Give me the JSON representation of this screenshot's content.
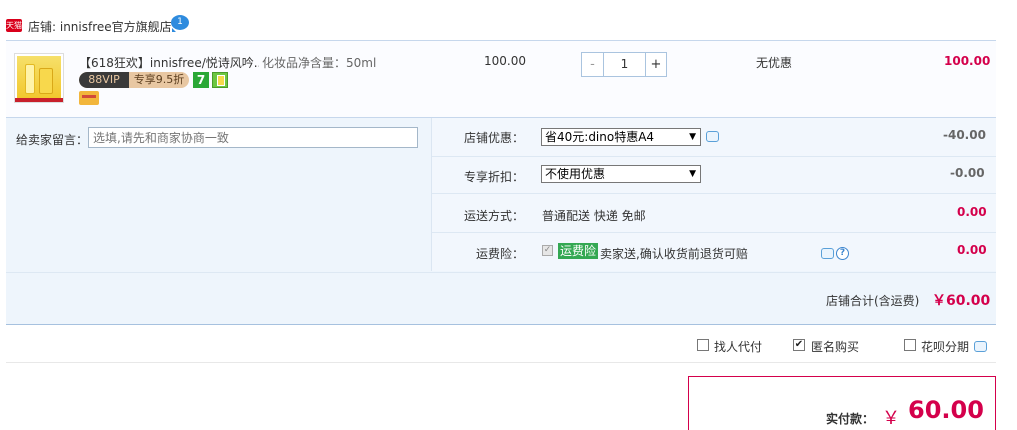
{
  "store": {
    "badge": "天猫",
    "label": "店铺: innisfree官方旗舰店",
    "chat_badge": "1"
  },
  "item": {
    "title": "【618狂欢】innisfree/悦诗风吟...",
    "spec": "化妆品净含量：50ml",
    "vip_left": "88VIP",
    "vip_right": "专享9.5折",
    "seven_icon": "7",
    "unit_price": "100.00",
    "quantity": "1",
    "qty_minus": "-",
    "qty_plus": "+",
    "discount": "无优惠",
    "total": "100.00"
  },
  "message": {
    "label": "给卖家留言：",
    "placeholder": "选填,请先和商家协商一致"
  },
  "options": {
    "store_coupon": {
      "label": "店铺优惠：",
      "selected": "省40元:dino特惠A4",
      "value": "-40.00"
    },
    "exclusive_discount": {
      "label": "专享折扣：",
      "selected": "不使用优惠",
      "value": "-0.00"
    },
    "shipping": {
      "label": "运送方式：",
      "text": "普通配送 快递 免邮",
      "value": "0.00"
    },
    "shipping_insurance": {
      "label": "运费险：",
      "badge": "运费险",
      "text": "卖家送,确认收货前退货可赔",
      "value": "0.00"
    }
  },
  "store_total": {
    "label": "店铺合计(含运费)",
    "value": "￥60.00"
  },
  "bottom": {
    "proxy_pay": {
      "label": "找人代付",
      "checked": false
    },
    "anonymous": {
      "label": "匿名购买",
      "checked": true
    },
    "installment": {
      "label": "花呗分期",
      "checked": false
    }
  },
  "payment": {
    "label": "实付款：",
    "currency": "￥",
    "value": "60.00"
  },
  "colors": {
    "price_red": "#d4004b",
    "border_blue": "#c6d7ec",
    "panel_bg": "#eef5fc"
  }
}
